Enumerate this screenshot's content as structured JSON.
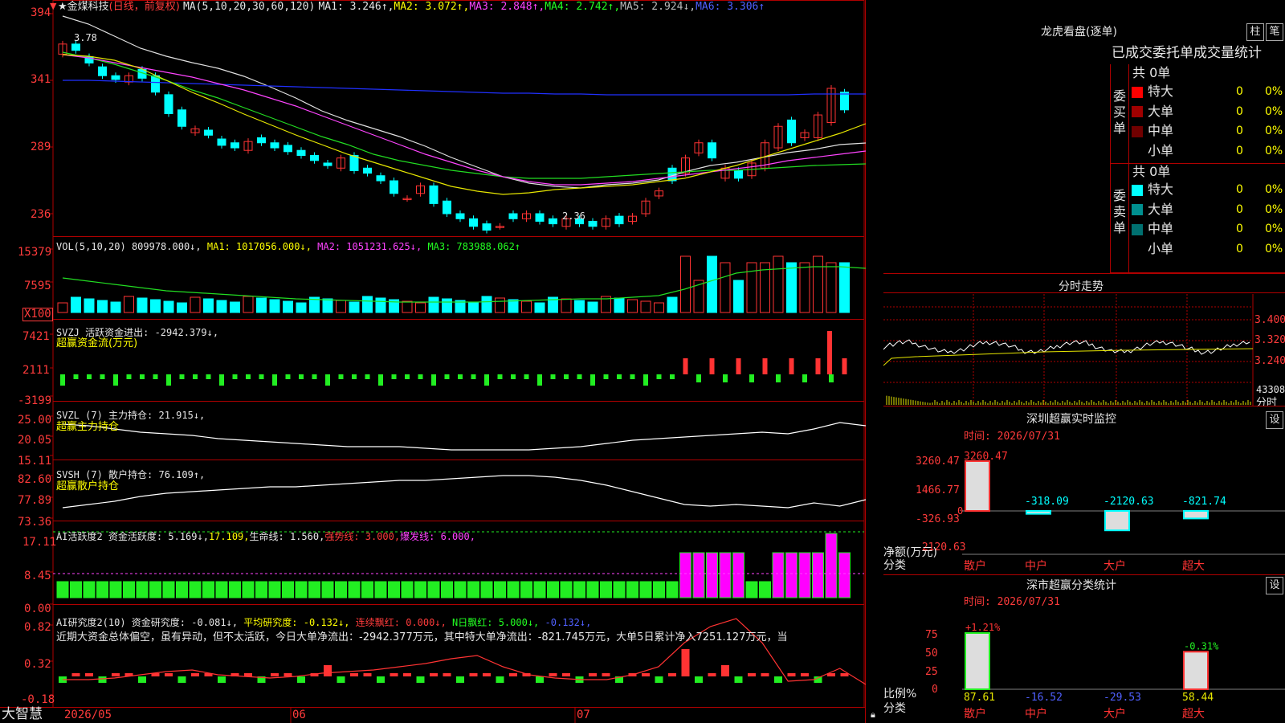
{
  "header": {
    "star": "★",
    "stock_name": "金煤科技",
    "period": "(日线，前复权)",
    "ma_label": "MA(5,10,20,30,60,120)",
    "ma1": "MA1: 3.246↑,",
    "ma2": "MA2: 3.072↑,",
    "ma3": "MA3: 2.848↑,",
    "ma4": "MA4: 2.742↑,",
    "ma5": "MA5: 2.924↓,",
    "ma6": "MA6: 3.306↑"
  },
  "price_axis": [
    "394",
    "341",
    "289",
    "236"
  ],
  "price_marks": {
    "high": "3.78",
    "low": "2.36"
  },
  "vol_panel": {
    "label": "VOL(5,10,20)",
    "v": "809978.000↓,",
    "ma1": "MA1: 1017056.000↓,",
    "ma2": "MA2: 1051231.625↓,",
    "ma3": "MA3: 783988.062↑",
    "axis": [
      "15379",
      "7595"
    ],
    "unit": "X100"
  },
  "svzj_panel": {
    "label": "SVZJ  活跃资金进出: -2942.379↓,",
    "sub": "超赢资金流(万元)",
    "axis": [
      "7421",
      "2111",
      "-3199"
    ]
  },
  "svzl_panel": {
    "label": "SVZL (7) 主力持仓: 21.915↓,",
    "sub": "超赢主力持仓",
    "axis": [
      "25.00",
      "20.05",
      "15.11"
    ]
  },
  "svsh_panel": {
    "label": "SVSH (7) 散户持仓: 76.109↑,",
    "sub": "超赢散户持仓",
    "axis": [
      "82.60",
      "77.89",
      "73.36"
    ]
  },
  "ai1_panel": {
    "label": "AI活跃度2 资金活跃度: 5.169↓,",
    "v2": "17.109,",
    "v3": "生命线: 1.560,",
    "v4": "强势线: 3.000,",
    "v5": "爆发线: 6.000,",
    "axis": [
      "17.11",
      "8.45",
      "0.00"
    ]
  },
  "ai2_panel": {
    "label": "AI研究度2(10) 资金研究度: -0.081↓,",
    "v2": "平均研究度: -0.132↓,",
    "v3": "连续飘红: 0.000↓,",
    "v4": "N日飘红: 5.000↓,",
    "v5": "-0.132↓,",
    "comment": "近期大资金总体偏空，虽有异动，但不太活跃，今日大单净流出：-2942.377万元，其中特大单净流出：-821.745万元，大单5日累计净入7251.127万元，当",
    "axis": [
      "0.82",
      "0.32",
      "-0.18"
    ]
  },
  "date_axis": {
    "logo": "大智慧",
    "d1": "2026/05",
    "d2": "06",
    "d3": "07"
  },
  "longhu": {
    "title": "龙虎看盘(逐单)",
    "btn1": "柱",
    "btn2": "笔",
    "subtitle": "已成交委托单成交量统计",
    "buy": {
      "side": "委买单",
      "total": "共 0单",
      "rows": [
        {
          "name": "特大",
          "val": "0",
          "pct": "0%",
          "color": "#ff0000"
        },
        {
          "name": "大单",
          "val": "0",
          "pct": "0%",
          "color": "#a00000"
        },
        {
          "name": "中单",
          "val": "0",
          "pct": "0%",
          "color": "#700000"
        },
        {
          "name": "小单",
          "val": "0",
          "pct": "0%",
          "color": "#000000"
        }
      ]
    },
    "sell": {
      "side": "委卖单",
      "total": "共 0单",
      "rows": [
        {
          "name": "特大",
          "val": "0",
          "pct": "0%",
          "color": "#00ffff"
        },
        {
          "name": "大单",
          "val": "0",
          "pct": "0%",
          "color": "#009090"
        },
        {
          "name": "中单",
          "val": "0",
          "pct": "0%",
          "color": "#007070"
        },
        {
          "name": "小单",
          "val": "0",
          "pct": "0%",
          "color": "#000000"
        }
      ]
    }
  },
  "intraday": {
    "title": "分时走势",
    "axis": [
      "3.400",
      "3.320",
      "3.240"
    ],
    "vol_label": "43308",
    "fen": "分时"
  },
  "monitor": {
    "title": "深圳超赢实时监控",
    "btn": "设",
    "time": "时间: 2026/07/31",
    "axis": [
      "3260.47",
      "1466.77",
      "0",
      "-326.93",
      "-2120.63"
    ],
    "net_label": "净额(万元)",
    "cat_label": "分类",
    "bars": [
      {
        "name": "散户",
        "value": 3260.47,
        "label": "3260.47"
      },
      {
        "name": "中户",
        "value": -318.09,
        "label": "-318.09"
      },
      {
        "name": "大户",
        "value": -2120.63,
        "label": "-2120.63"
      },
      {
        "name": "超大",
        "value": -821.74,
        "label": "-821.74"
      }
    ]
  },
  "classify": {
    "title": "深市超赢分类统计",
    "btn": "设",
    "time": "时间: 2026/07/31",
    "axis": [
      "75",
      "50",
      "25",
      "0"
    ],
    "ratio_label": "比例%",
    "cat_label": "分类",
    "pct_scale": [
      1.21,
      -0.31
    ],
    "bars": [
      {
        "name": "散户",
        "top": "+1.21%",
        "bottom": "87.61",
        "value": 87.61,
        "show": true
      },
      {
        "name": "中户",
        "top": "",
        "bottom": "-16.52",
        "value": -16.52,
        "show": false
      },
      {
        "name": "大户",
        "top": "",
        "bottom": "-29.53",
        "value": -29.53,
        "show": false
      },
      {
        "name": "超大",
        "top": "-0.31%",
        "bottom": "58.44",
        "value": 58.44,
        "show": true
      }
    ]
  },
  "colors": {
    "up": "#ff3333",
    "down": "#00ffff",
    "grid": "#b00000"
  }
}
